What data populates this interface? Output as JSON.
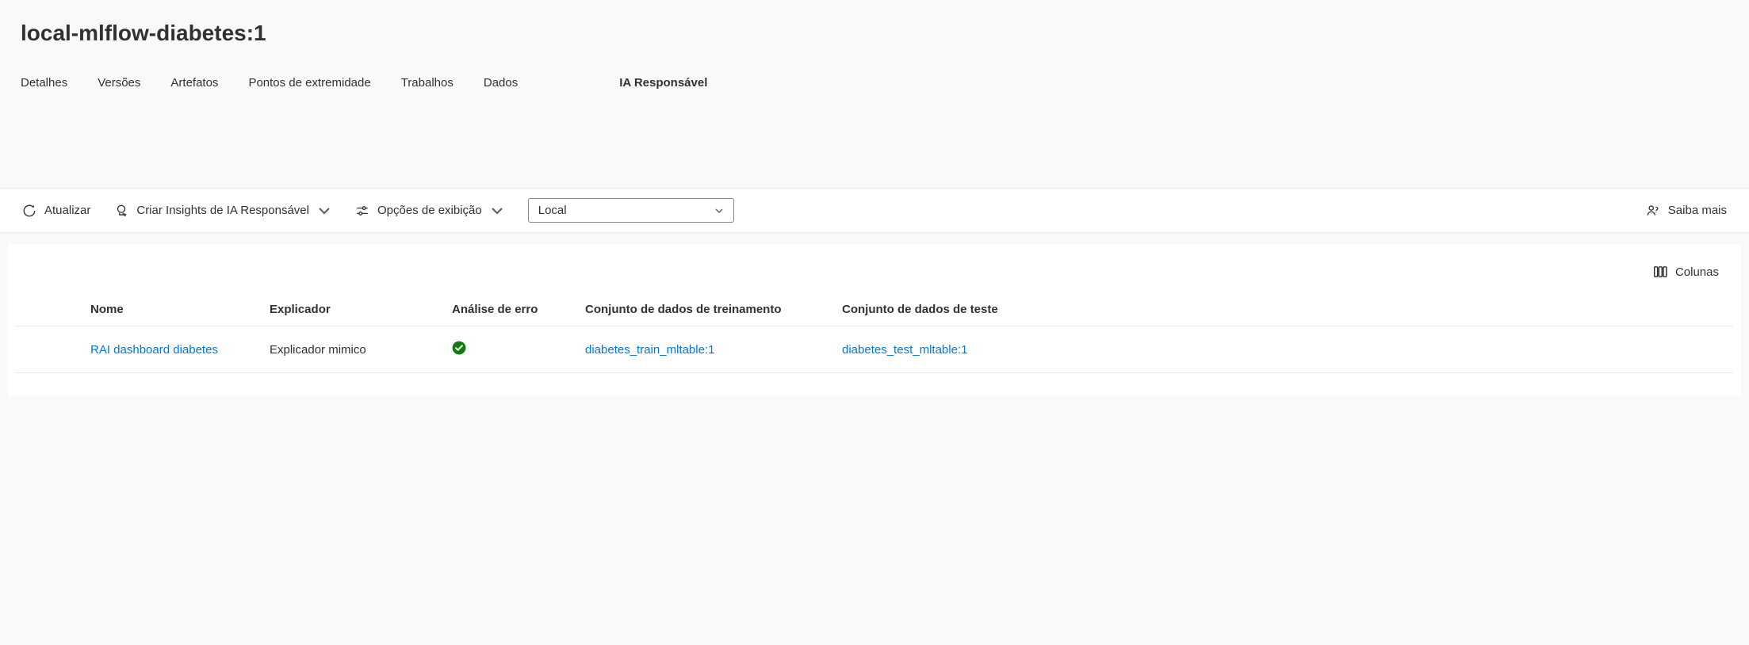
{
  "title": "local-mlflow-diabetes:1",
  "tabs": {
    "details": "Detalhes",
    "versions": "Versões",
    "artifacts": "Artefatos",
    "endpoints": "Pontos de extremidade",
    "jobs": "Trabalhos",
    "data": "Dados",
    "responsible_ai": "IA Responsável"
  },
  "toolbar": {
    "refresh": "Atualizar",
    "create_rai": "Criar Insights de IA Responsável",
    "view_options": "Opções de exibição",
    "scope_selected": "Local",
    "learn_more": "Saiba mais",
    "columns": "Colunas"
  },
  "table": {
    "headers": {
      "name": "Nome",
      "explainer": "Explicador",
      "error_analysis": "Análise de erro",
      "train_dataset": "Conjunto de dados de treinamento",
      "test_dataset": "Conjunto de dados de teste"
    },
    "rows": [
      {
        "name": "RAI dashboard diabetes",
        "explainer": "Explicador mimico",
        "train_dataset": "diabetes_train_mltable:1",
        "test_dataset": "diabetes_test_mltable:1"
      }
    ]
  }
}
